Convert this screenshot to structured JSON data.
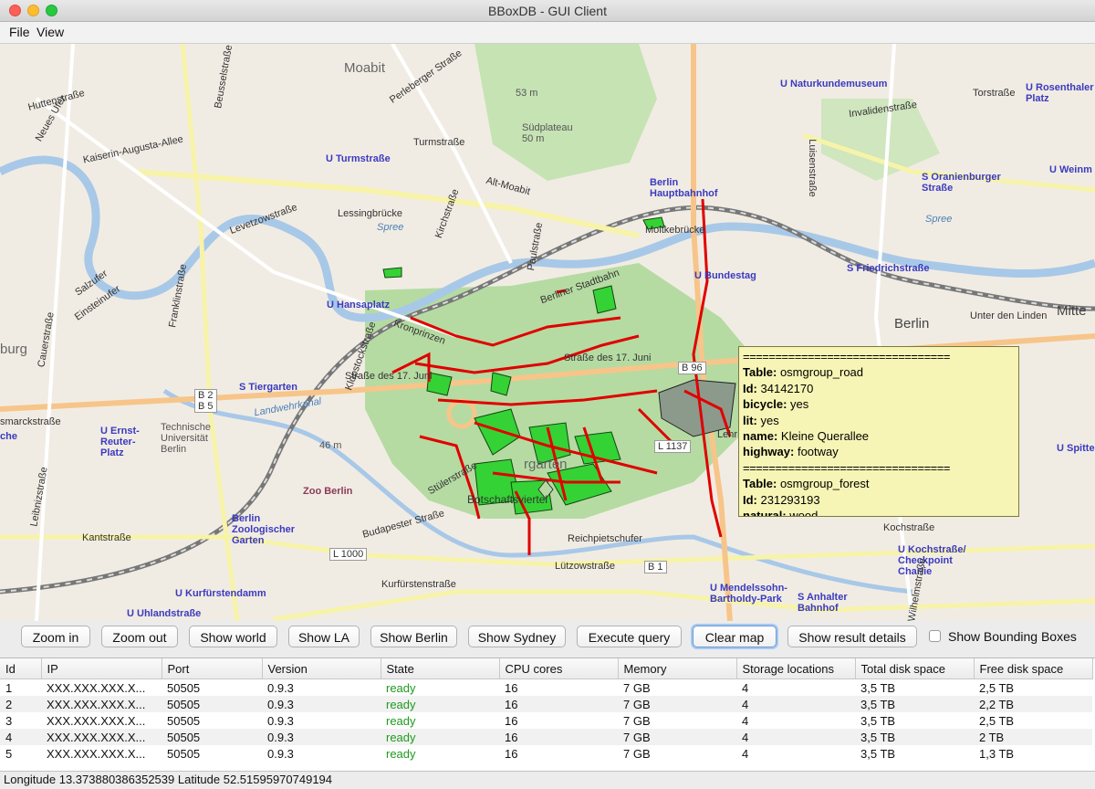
{
  "window": {
    "title": "BBoxDB - GUI Client"
  },
  "menu": {
    "file": "File",
    "view": "View"
  },
  "map": {
    "labels": {
      "moabit": "Moabit",
      "naturkunde": "U Naturkundemuseum",
      "rosenthaler": "U Rosenthaler Platz",
      "turmstrasse": "U Turmstraße",
      "hauptbahnhof": "Berlin Hauptbahnhof",
      "oranienburger": "S Oranienburger Straße",
      "weinm": "U Weinm",
      "lessingbruecke": "Lessingbrücke",
      "spree1": "Spree",
      "spree2": "Spree",
      "moltkebruecke": "Moltkebrücke",
      "bundestag": "U Bundestag",
      "friedrichstrasse": "S Friedrichstraße",
      "hansaplatz": "U Hansaplatz",
      "berlin": "Berlin",
      "unterdenlinden": "Unter den Linden",
      "mitte": "Mitte",
      "burg": "burg",
      "tiergarten_s": "S Tiergarten",
      "strasse17juni_1": "Straße des 17. Juni",
      "strasse17juni_2": "Straße des 17. Juni",
      "b96": "B 96",
      "b2b5": "B 2\nB 5",
      "tu": "Technische Universität Berlin",
      "ernstreuter": "U Ernst-Reuter-Platz",
      "l1137": "L 1137",
      "m46": "46 m",
      "tiergarten_dist": "rgarten",
      "zooberlin": "Zoo Berlin",
      "botschafts": "Botschaftsviertel",
      "zoologischer": "Berlin Zoologischer Garten",
      "l1000": "L 1000",
      "kochstrasse": "U Kochstraße/ Checkpoint Charlie",
      "mendelssohn": "U Mendelssohn-Bartholdy-Park",
      "anhalter": "S Anhalter Bahnhof",
      "kurfuerstendamm": "U Kurfürstendamm",
      "uhlandstrasse": "U Uhlandstraße",
      "b1": "B 1",
      "suedplateau": "Südplateau 50 m",
      "m53": "53 m",
      "spitte": "U Spitte",
      "che": "che",
      "kantstrasse": "Kantstraße",
      "budapester": "Budapester Straße",
      "reichpietsch": "Reichpietschufer",
      "luetzow": "Lützowstraße",
      "kurfuerstenstr": "Kurfürstenstraße",
      "kochstrasse_street": "Kochstraße",
      "alt_moabit": "Alt-Moabit",
      "turmstrasse_street": "Turmstraße",
      "kaiserin": "Kaiserin-Augusta-Allee",
      "huttenstrasse": "Huttenstraße",
      "invalidenstr": "Invalidenstraße",
      "torstrasse": "Torstraße",
      "luisenstrasse": "Luisenstraße",
      "levetzowstrasse": "Levetzowstraße",
      "paulstrasse": "Paulstraße",
      "kirchstrasse": "Kirchstraße",
      "franklinstrasse": "Franklinstraße",
      "salzufer": "Salzufer",
      "einsteinufer": "Einsteinufer",
      "landwehrkanal": "Landwehrkanal",
      "smarckstrasse": "smarckstraße",
      "leibnizstrasse": "Leibnizstraße",
      "wilhelmstrasse": "Wilhelmstraße",
      "stuelerstrasse": "Stülerstraße",
      "lehr": "Lehr",
      "beusselstrasse": "Beusselstraße",
      "perleberger": "Perleberger Straße",
      "berliner_stadtbahn": "Berliner Stadtbahn",
      "klopstockstrasse": "Klopstockstraße",
      "kronprinzen": "Kronprinzen",
      "neues_ufer": "Neues Ufer",
      "cauerstrasse": "Cauerstraße"
    },
    "tooltip": {
      "separator": "================================",
      "entries": [
        {
          "table_label": "Table:",
          "table": "osmgroup_road",
          "id_label": "Id:",
          "id": "34142170",
          "fields": [
            {
              "key": "bicycle:",
              "value": "yes"
            },
            {
              "key": "lit:",
              "value": "yes"
            },
            {
              "key": "name:",
              "value": "Kleine Querallee"
            },
            {
              "key": "highway:",
              "value": "footway"
            }
          ]
        },
        {
          "table_label": "Table:",
          "table": "osmgroup_forest",
          "id_label": "Id:",
          "id": "231293193",
          "fields": [
            {
              "key": "natural:",
              "value": "wood"
            }
          ]
        }
      ]
    }
  },
  "toolbar": {
    "zoom_in": "Zoom in",
    "zoom_out": "Zoom out",
    "show_world": "Show world",
    "show_la": "Show LA",
    "show_berlin": "Show Berlin",
    "show_sydney": "Show Sydney",
    "execute_query": "Execute query",
    "clear_map": "Clear map",
    "show_result_details": "Show result details",
    "show_bounding_boxes": "Show Bounding Boxes"
  },
  "table": {
    "columns": [
      "Id",
      "IP",
      "Port",
      "Version",
      "State",
      "CPU cores",
      "Memory",
      "Storage locations",
      "Total disk space",
      "Free disk space"
    ],
    "rows": [
      [
        "1",
        "XXX.XXX.XXX.X...",
        "50505",
        "0.9.3",
        "ready",
        "16",
        "7 GB",
        "4",
        "3,5 TB",
        "2,5 TB"
      ],
      [
        "2",
        "XXX.XXX.XXX.X...",
        "50505",
        "0.9.3",
        "ready",
        "16",
        "7 GB",
        "4",
        "3,5 TB",
        "2,2 TB"
      ],
      [
        "3",
        "XXX.XXX.XXX.X...",
        "50505",
        "0.9.3",
        "ready",
        "16",
        "7 GB",
        "4",
        "3,5 TB",
        "2,5 TB"
      ],
      [
        "4",
        "XXX.XXX.XXX.X...",
        "50505",
        "0.9.3",
        "ready",
        "16",
        "7 GB",
        "4",
        "3,5 TB",
        "2 TB"
      ],
      [
        "5",
        "XXX.XXX.XXX.X...",
        "50505",
        "0.9.3",
        "ready",
        "16",
        "7 GB",
        "4",
        "3,5 TB",
        "1,3 TB"
      ]
    ]
  },
  "status": {
    "text": "Longitude 13.373880386352539 Latitude 52.51595970749194"
  },
  "colors": {
    "accent": "#6a9cd8",
    "ready": "#1e9a1e",
    "tooltip_bg": "#f7f5b5",
    "query_road": "#e00000",
    "query_forest": "#33cc33"
  }
}
